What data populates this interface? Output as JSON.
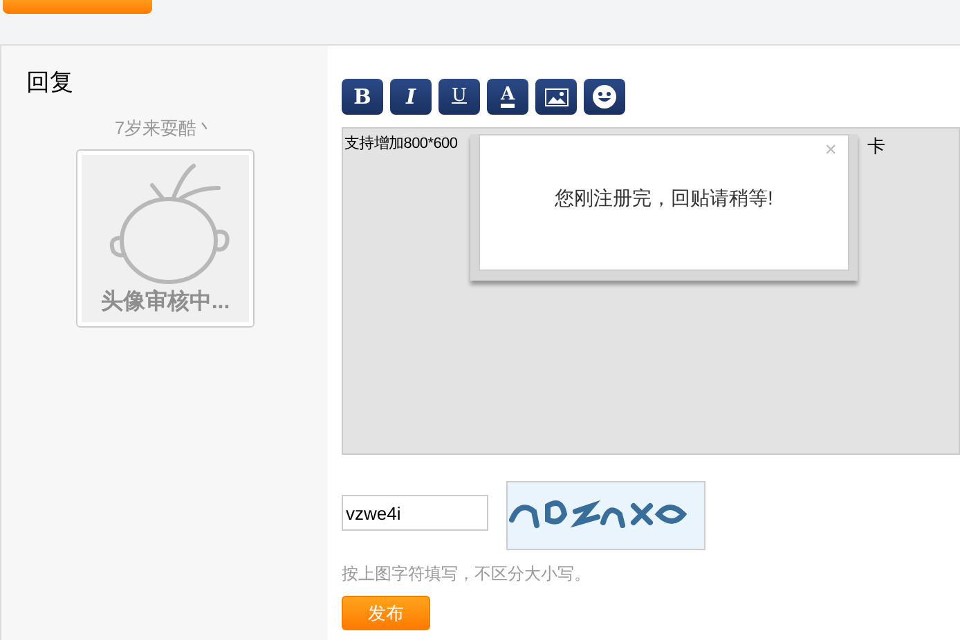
{
  "reply": {
    "title": "回复"
  },
  "user": {
    "name": "7岁来耍酷丶",
    "avatar_caption": "头像审核中..."
  },
  "toolbar": [
    {
      "kind": "bold",
      "label": "B"
    },
    {
      "kind": "italic",
      "label": "I"
    },
    {
      "kind": "underline",
      "label": "U"
    },
    {
      "kind": "color",
      "label": "A"
    },
    {
      "kind": "image"
    },
    {
      "kind": "emoji"
    }
  ],
  "editor": {
    "text_start": "支持增加800*600",
    "text_end": "卡"
  },
  "dialog": {
    "close": "×",
    "message": "您刚注册完，回贴请稍等!"
  },
  "captcha": {
    "value": "vzwe4i",
    "hint": "按上图字符填写，不区分大小写。"
  },
  "submit": "发布"
}
